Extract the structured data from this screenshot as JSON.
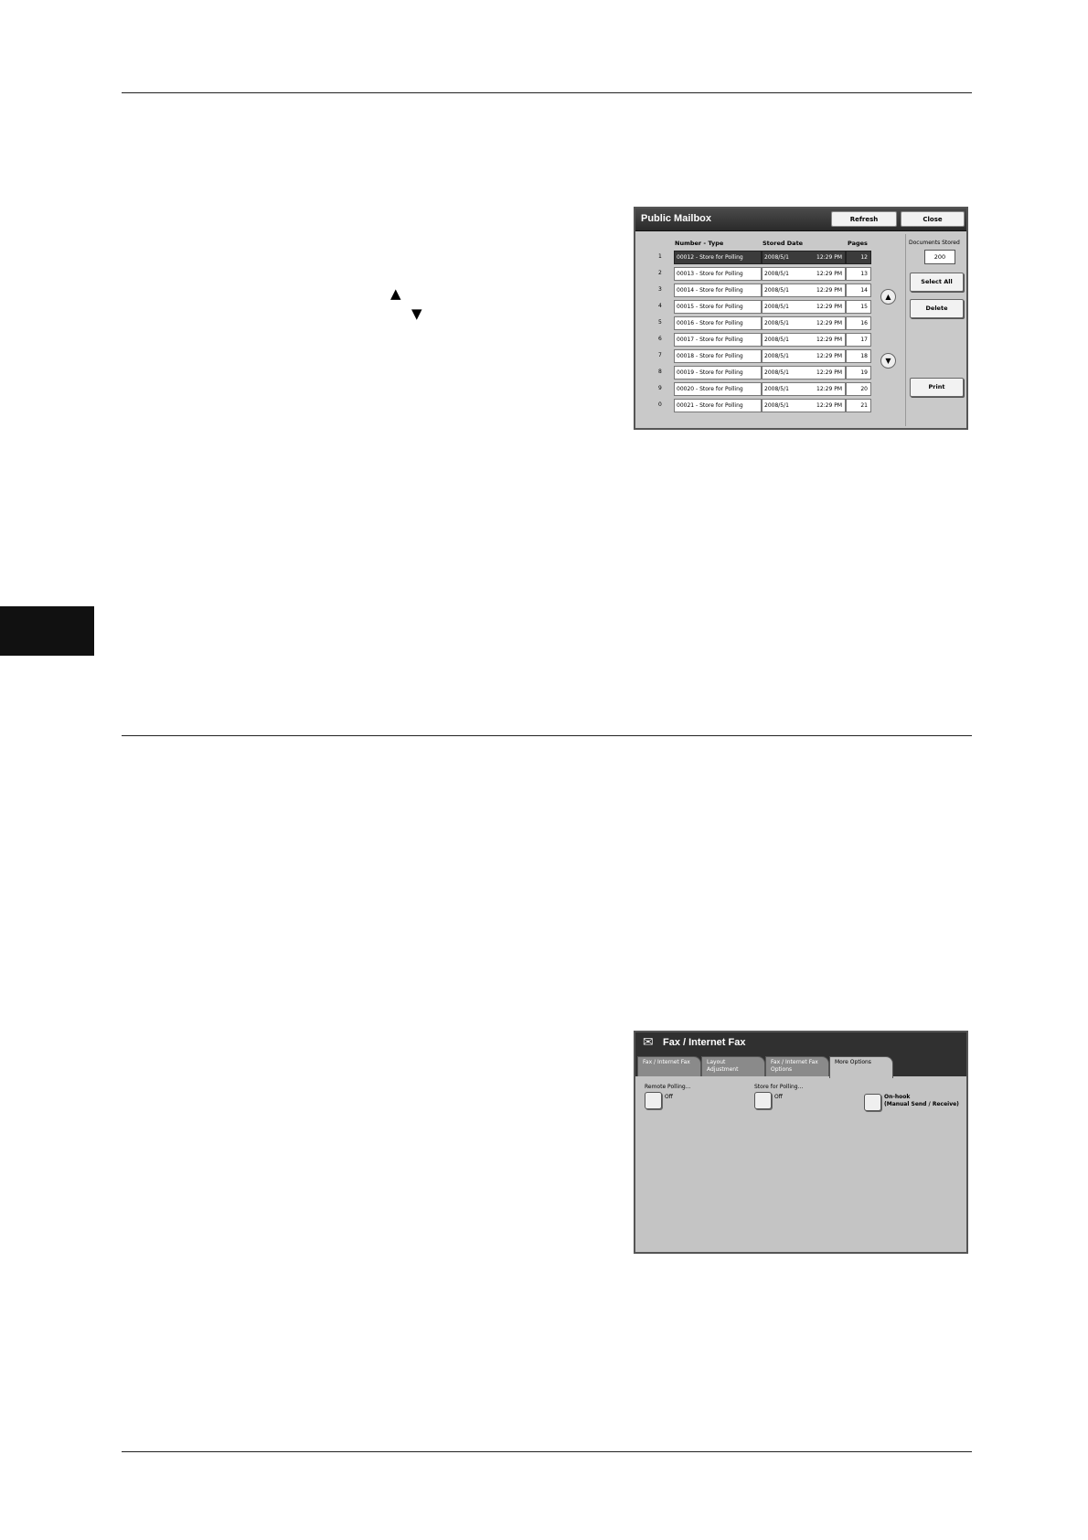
{
  "page": {
    "up_arrow": "▲",
    "down_arrow": "▼"
  },
  "mailbox": {
    "title": "Public Mailbox",
    "refresh_label": "Refresh",
    "close_label": "Close",
    "col_number_type": "Number - Type",
    "col_stored_date": "Stored Date",
    "col_pages": "Pages",
    "documents_stored_label": "Documents Stored",
    "documents_stored_value": "200",
    "select_all_label": "Select All",
    "delete_label": "Delete",
    "print_label": "Print",
    "rows": [
      {
        "idx": "1",
        "name": "00012 - Store for Polling",
        "date": "2008/5/1",
        "time": "12:29 PM",
        "pages": "12"
      },
      {
        "idx": "2",
        "name": "00013 - Store for Polling",
        "date": "2008/5/1",
        "time": "12:29 PM",
        "pages": "13"
      },
      {
        "idx": "3",
        "name": "00014 - Store for Polling",
        "date": "2008/5/1",
        "time": "12:29 PM",
        "pages": "14"
      },
      {
        "idx": "4",
        "name": "00015 - Store for Polling",
        "date": "2008/5/1",
        "time": "12:29 PM",
        "pages": "15"
      },
      {
        "idx": "5",
        "name": "00016 - Store for Polling",
        "date": "2008/5/1",
        "time": "12:29 PM",
        "pages": "16"
      },
      {
        "idx": "6",
        "name": "00017 - Store for Polling",
        "date": "2008/5/1",
        "time": "12:29 PM",
        "pages": "17"
      },
      {
        "idx": "7",
        "name": "00018 - Store for Polling",
        "date": "2008/5/1",
        "time": "12:29 PM",
        "pages": "18"
      },
      {
        "idx": "8",
        "name": "00019 - Store for Polling",
        "date": "2008/5/1",
        "time": "12:29 PM",
        "pages": "19"
      },
      {
        "idx": "9",
        "name": "00020 - Store for Polling",
        "date": "2008/5/1",
        "time": "12:29 PM",
        "pages": "20"
      },
      {
        "idx": "0",
        "name": "00021 - Store for Polling",
        "date": "2008/5/1",
        "time": "12:29 PM",
        "pages": "21"
      }
    ]
  },
  "fax": {
    "title": "Fax / Internet Fax",
    "tabs": [
      {
        "line1": "Fax / Internet Fax",
        "line2": ""
      },
      {
        "line1": "Layout",
        "line2": "Adjustment"
      },
      {
        "line1": "Fax / Internet Fax",
        "line2": "Options"
      },
      {
        "line1": "More Options",
        "line2": ""
      }
    ],
    "remote_polling_label": "Remote Polling...",
    "remote_polling_value": "Off",
    "store_polling_label": "Store for Polling...",
    "store_polling_value": "Off",
    "onhook_line1": "On-hook",
    "onhook_line2": "(Manual Send / Receive)"
  },
  "colors": {
    "titlebar": "#2a2a2a",
    "panel": "#c9c9c9",
    "selected_row": "#3b3b3b"
  }
}
